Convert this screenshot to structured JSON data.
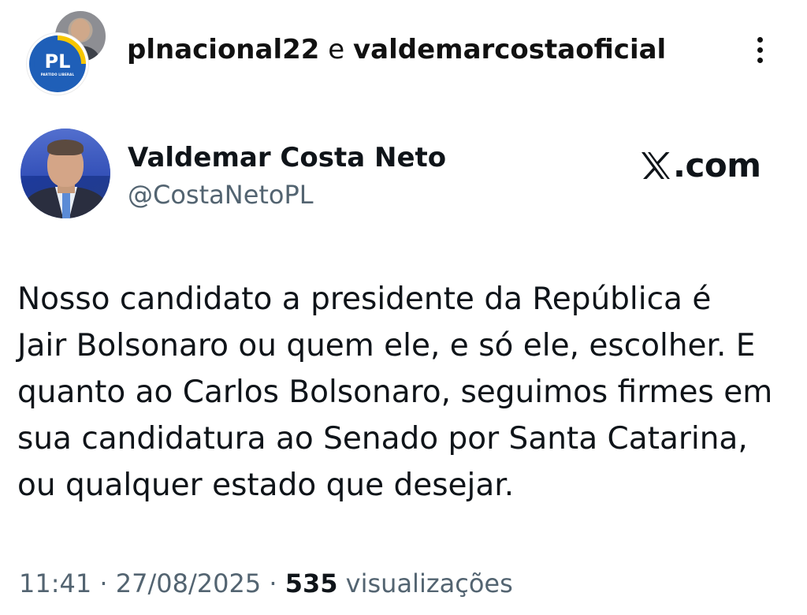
{
  "post_header": {
    "account_primary": "plnacional22",
    "connector": " e ",
    "account_secondary": "valdemarcostaoficial",
    "logo_text": "PL",
    "logo_subtext": "PARTIDO LIBERAL",
    "menu_icon": "more-vertical-icon"
  },
  "tweet": {
    "author_name": "Valdemar Costa Neto",
    "author_handle": "@CostaNetoPL",
    "source_label": ".com",
    "text_lines": [
      "Nosso candidato a presidente da República é",
      "Jair Bolsonaro ou quem ele, e só ele, escolher. E",
      "quanto ao Carlos Bolsonaro, seguimos firmes em",
      "sua candidatura ao Senado por Santa Catarina,",
      "ou qualquer estado que desejar."
    ],
    "time": "11:41",
    "separator": " · ",
    "date": "27/08/2025",
    "views_count": "535",
    "views_label": " visualizações"
  },
  "colors": {
    "text_primary": "#0f1419",
    "text_secondary": "#536471",
    "pl_blue": "#1f5fb8",
    "pl_yellow": "#f7c600",
    "background": "#ffffff"
  }
}
